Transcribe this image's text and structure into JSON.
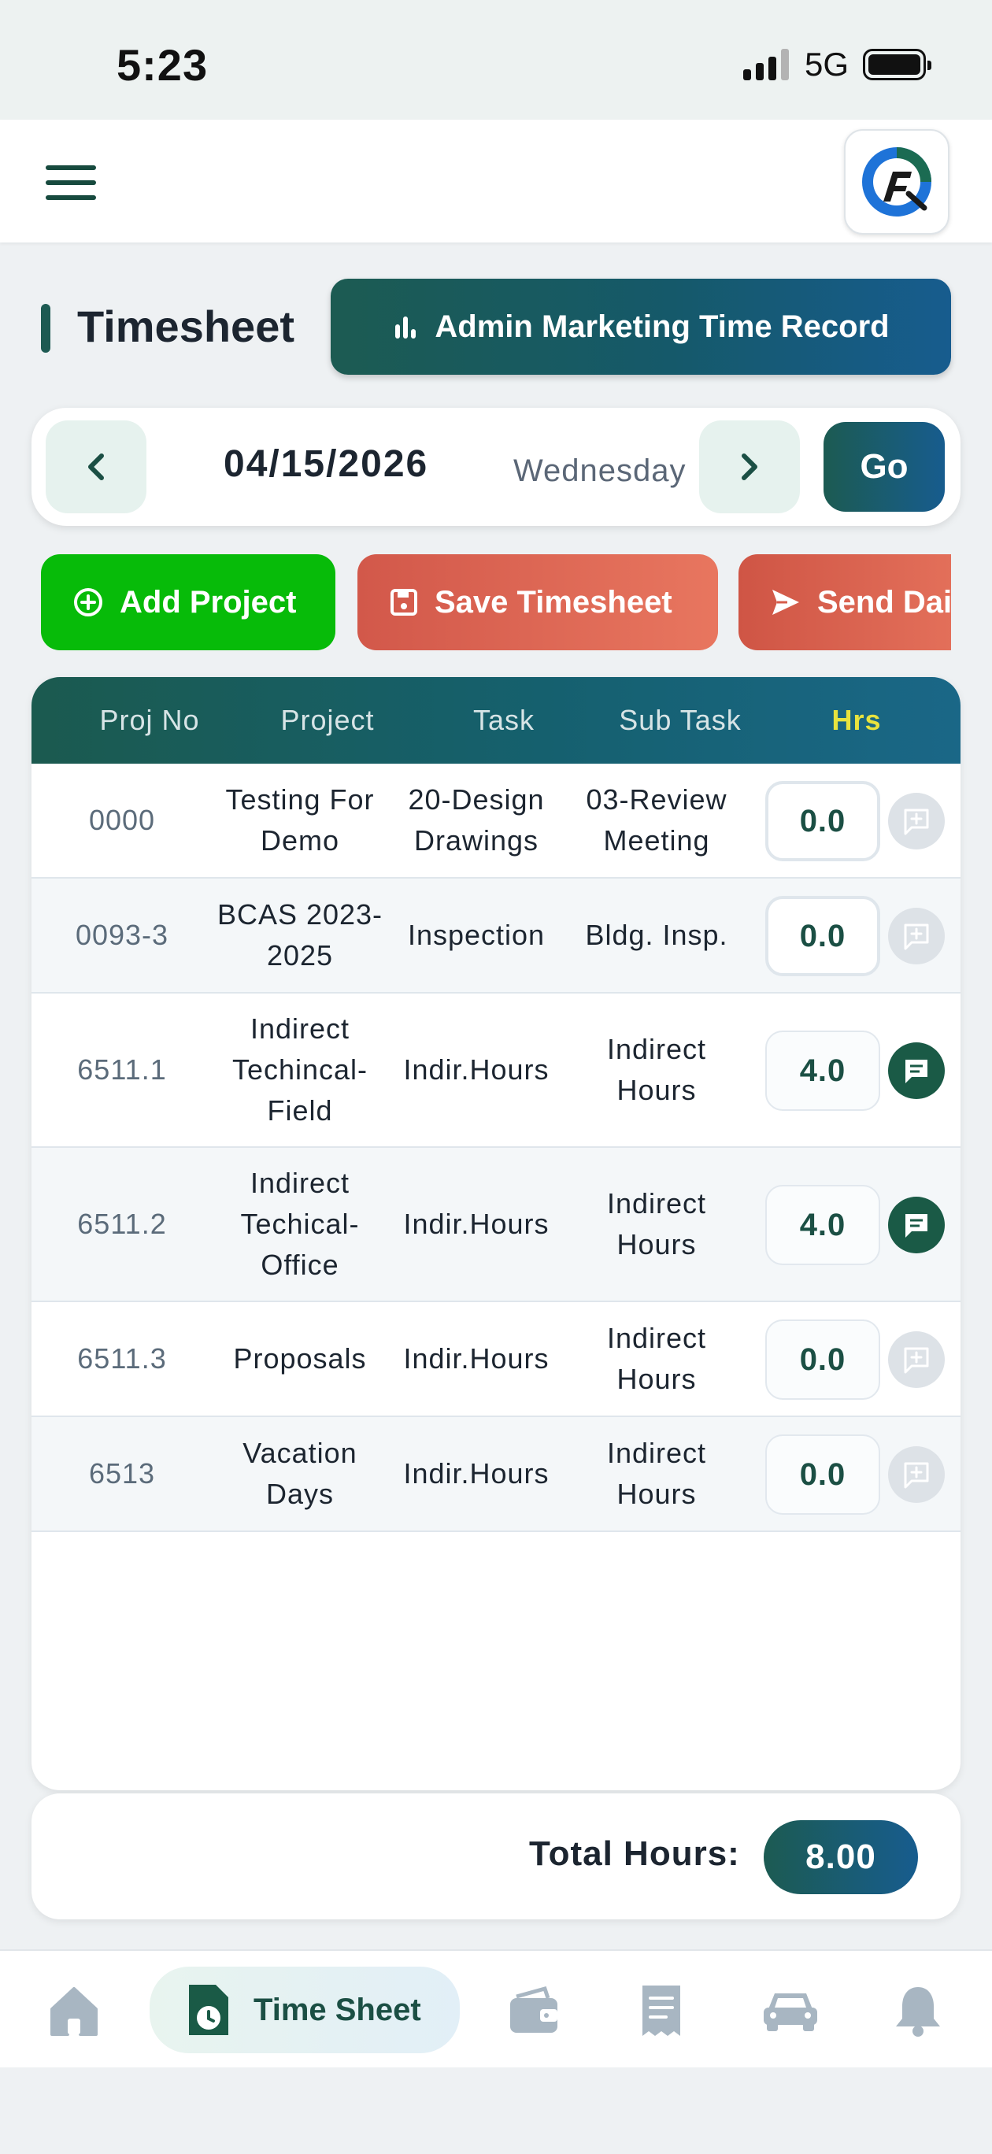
{
  "status_bar": {
    "time": "5:23",
    "network": "5G"
  },
  "header": {
    "menu_icon": "hamburger-menu-icon",
    "logo_icon": "company-logo"
  },
  "page": {
    "title": "Timesheet",
    "admin_button_label": "Admin Marketing Time Record"
  },
  "date_nav": {
    "date": "04/15/2026",
    "weekday": "Wednesday",
    "go_label": "Go"
  },
  "actions": {
    "add_project": "Add Project",
    "save_timesheet": "Save Timesheet",
    "send_daily": "Send Daily"
  },
  "table": {
    "columns": [
      "Proj No",
      "Project",
      "Task",
      "Sub Task",
      "Hrs"
    ],
    "rows": [
      {
        "proj_no": "0000",
        "project": "Testing For Demo",
        "task": "20-Design Drawings",
        "sub_task": "03-Review Meeting",
        "hrs": "0.0",
        "editable": true,
        "has_note": false
      },
      {
        "proj_no": "0093-3",
        "project": "BCAS 2023-2025",
        "task": "Inspection",
        "sub_task": "Bldg. Insp.",
        "hrs": "0.0",
        "editable": true,
        "has_note": false
      },
      {
        "proj_no": "6511.1",
        "project": "Indirect Techincal-Field",
        "task": "Indir.Hours",
        "sub_task": "Indirect Hours",
        "hrs": "4.0",
        "editable": false,
        "has_note": true
      },
      {
        "proj_no": "6511.2",
        "project": "Indirect Techical-Office",
        "task": "Indir.Hours",
        "sub_task": "Indirect Hours",
        "hrs": "4.0",
        "editable": false,
        "has_note": true
      },
      {
        "proj_no": "6511.3",
        "project": "Proposals",
        "task": "Indir.Hours",
        "sub_task": "Indirect Hours",
        "hrs": "0.0",
        "editable": false,
        "has_note": false
      },
      {
        "proj_no": "6513",
        "project": "Vacation Days",
        "task": "Indir.Hours",
        "sub_task": "Indirect Hours",
        "hrs": "0.0",
        "editable": false,
        "has_note": false
      }
    ]
  },
  "total": {
    "label": "Total Hours:",
    "value": "8.00"
  },
  "bottom_nav": {
    "active_label": "Time Sheet",
    "items": [
      "home-icon",
      "timesheet-icon",
      "wallet-icon",
      "receipt-icon",
      "car-icon",
      "bell-icon"
    ]
  },
  "colors": {
    "brand_dark": "#1c5b52",
    "brand_blue": "#175c8e",
    "add_green": "#07bb09",
    "save_red": "#d2584a",
    "hrs_header": "#e8e33e"
  }
}
